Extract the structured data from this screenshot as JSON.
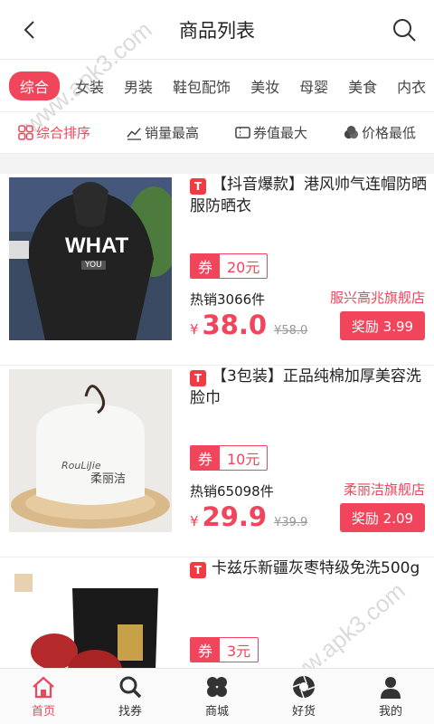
{
  "header": {
    "title": "商品列表",
    "back_icon": "chevron-left-icon",
    "search_icon": "search-icon"
  },
  "categories": [
    {
      "label": "综合",
      "active": true
    },
    {
      "label": "女装"
    },
    {
      "label": "男装"
    },
    {
      "label": "鞋包配饰"
    },
    {
      "label": "美妆"
    },
    {
      "label": "母婴"
    },
    {
      "label": "美食"
    },
    {
      "label": "内衣"
    }
  ],
  "sorts": [
    {
      "label": "综合排序",
      "icon": "grid-icon",
      "active": true
    },
    {
      "label": "销量最高",
      "icon": "trend-chart-icon"
    },
    {
      "label": "券值最大",
      "icon": "ticket-icon"
    },
    {
      "label": "价格最低",
      "icon": "coins-icon"
    }
  ],
  "products": [
    {
      "title": "【抖音爆款】港风帅气连帽防晒服防晒衣",
      "coupon_key": "券",
      "coupon_value": "20元",
      "sold": "热销3066件",
      "shop": "服兴高兆旗舰店",
      "currency": "¥",
      "price": "38.0",
      "old_price": "¥58.0",
      "reward": "奖励 3.99",
      "image_text": "WHAT",
      "image_subtext": "YOU"
    },
    {
      "title": "【3包装】正品纯棉加厚美容洗脸巾",
      "coupon_key": "券",
      "coupon_value": "10元",
      "sold": "热销65098件",
      "shop": "柔丽洁旗舰店",
      "currency": "¥",
      "price": "29.9",
      "old_price": "¥39.9",
      "reward": "奖励 2.09",
      "image_text": "柔丽洁",
      "image_subtext": "RouLiJie"
    },
    {
      "title": "卡兹乐新疆灰枣特级免洗500g",
      "coupon_key": "券",
      "coupon_value": "3元"
    }
  ],
  "tabs": [
    {
      "label": "首页",
      "icon": "home-icon",
      "active": true
    },
    {
      "label": "找券",
      "icon": "search-icon"
    },
    {
      "label": "商城",
      "icon": "clover-icon"
    },
    {
      "label": "好货",
      "icon": "shutter-icon"
    },
    {
      "label": "我的",
      "icon": "user-icon"
    }
  ],
  "watermark": "www.apk3.com",
  "colors": {
    "accent": "#f0455a",
    "tmall_badge": "#f03b42"
  }
}
